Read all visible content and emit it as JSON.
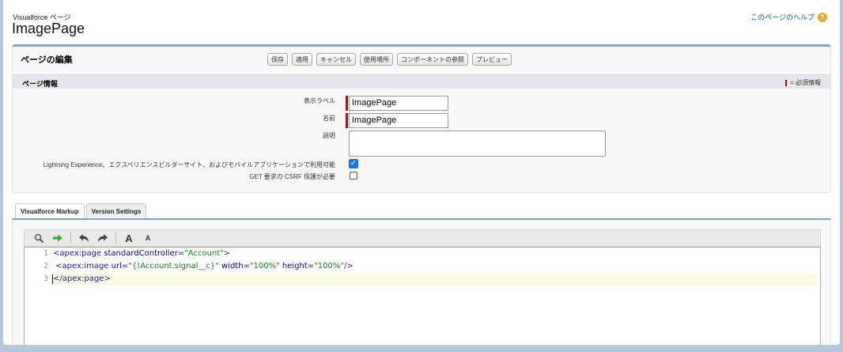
{
  "header": {
    "subtitle": "Visualforce ページ",
    "title": "ImagePage",
    "help_link": "このページのヘルプ",
    "help_icon": "?"
  },
  "edit": {
    "title": "ページの編集",
    "buttons": [
      "保存",
      "適用",
      "キャンセル",
      "使用場所",
      "コンポーネントの参照",
      "プレビュー"
    ]
  },
  "info": {
    "title": "ページ情報",
    "required_legend": "= 必須情報",
    "label_field": {
      "label": "表示ラベル",
      "value": "ImagePage"
    },
    "name_field": {
      "label": "名前",
      "value": "ImagePage"
    },
    "description_field": {
      "label": "説明",
      "value": ""
    },
    "lightning_field": {
      "label": "Lightning Experience、エクスペリエンスビルダーサイト、およびモバイルアプリケーションで利用可能",
      "checked": true
    },
    "csrf_field": {
      "label": "GET 要求の CSRF 保護が必要",
      "checked": false
    }
  },
  "tabs": [
    "Visualforce Markup",
    "Version Settings"
  ],
  "editor": {
    "toolbar_icons": [
      "search-icon",
      "go-arrow-icon",
      "undo-icon",
      "redo-icon",
      "font-larger-icon",
      "font-smaller-icon"
    ],
    "toolbar_glyphs": {
      "font_larger": "A",
      "font_smaller": "A"
    },
    "line_numbers": [
      "1",
      "2",
      "3"
    ],
    "lines": {
      "l1_tag": "<apex:page",
      "l1_attr": " standardController=",
      "l1_val": "\"Account\"",
      "l1_end": ">",
      "l2_tag": " <apex:image",
      "l2_attr1": " url=",
      "l2_val1": "\"{!Account.signal__c}\"",
      "l2_attr2": " width=",
      "l2_val2": "\"100%\"",
      "l2_attr3": " height=",
      "l2_val3": "\"100%\"",
      "l2_end": "/>",
      "l3_tag": "</apex:page>"
    }
  },
  "colors": {
    "accent_bar": "#8a9ebe",
    "required": "#cc0000",
    "checkbox": "#1a73e8",
    "help_icon": "#e8a52a"
  }
}
